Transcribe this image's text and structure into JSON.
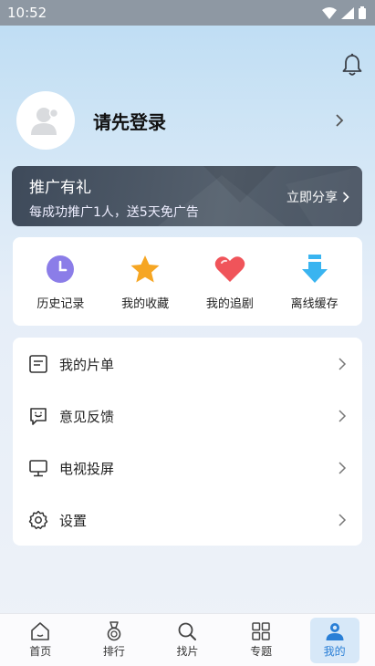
{
  "status_bar": {
    "time": "10:52",
    "icons": [
      "wifi-icon",
      "signal-icon",
      "battery-icon"
    ]
  },
  "header": {
    "icon": "bell-icon"
  },
  "profile": {
    "login_prompt": "请先登录",
    "icons": [
      "avatar",
      "chevron-right-icon"
    ]
  },
  "promo": {
    "title": "推广有礼",
    "subtitle": "每成功推广1人，送5天免广告",
    "share_label": "立即分享"
  },
  "quick_actions": [
    {
      "label": "历史记录",
      "icon": "clock-icon"
    },
    {
      "label": "我的收藏",
      "icon": "star-icon"
    },
    {
      "label": "我的追剧",
      "icon": "heart-icon"
    },
    {
      "label": "离线缓存",
      "icon": "download-arrow-icon"
    }
  ],
  "menu": [
    {
      "label": "我的片单",
      "icon": "playlist-icon"
    },
    {
      "label": "意见反馈",
      "icon": "feedback-icon"
    },
    {
      "label": "电视投屏",
      "icon": "tv-cast-icon"
    },
    {
      "label": "设置",
      "icon": "gear-icon"
    }
  ],
  "tabbar": {
    "active": "我的",
    "tabs": [
      {
        "label": "首页",
        "icon": "home-icon"
      },
      {
        "label": "排行",
        "icon": "medal-icon"
      },
      {
        "label": "找片",
        "icon": "search-icon"
      },
      {
        "label": "专题",
        "icon": "grid-icon"
      },
      {
        "label": "我的",
        "icon": "user-icon"
      }
    ]
  },
  "colors": {
    "accent": "#2a7fd6",
    "promo_bg": "#4a5563",
    "star": "#f6a623",
    "heart": "#f0545a",
    "clock": "#8b7de8",
    "download": "#39b4f0"
  }
}
